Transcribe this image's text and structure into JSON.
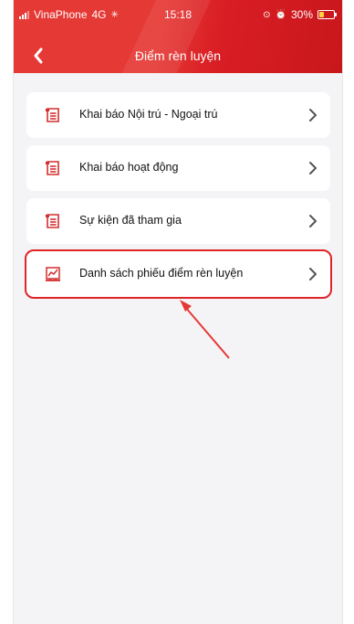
{
  "status_bar": {
    "carrier": "VinaPhone",
    "network": "4G",
    "time": "15:18",
    "battery_percent": "30%",
    "battery_level": 0.3
  },
  "header": {
    "title": "Điểm rèn luyện",
    "back_icon": "chevron-left-icon"
  },
  "menu": {
    "items": [
      {
        "label": "Khai báo Nội trú - Ngoại trú",
        "icon": "document-list-icon"
      },
      {
        "label": "Khai báo hoạt động",
        "icon": "document-list-icon"
      },
      {
        "label": "Sự kiện đã tham gia",
        "icon": "document-list-icon"
      },
      {
        "label": "Danh sách phiếu điểm rèn luyện",
        "icon": "report-chart-icon"
      }
    ]
  },
  "colors": {
    "header_red": "#e53935",
    "accent_red": "#d32f2f",
    "highlight_red": "#e02427",
    "background": "#f4f4f6"
  }
}
